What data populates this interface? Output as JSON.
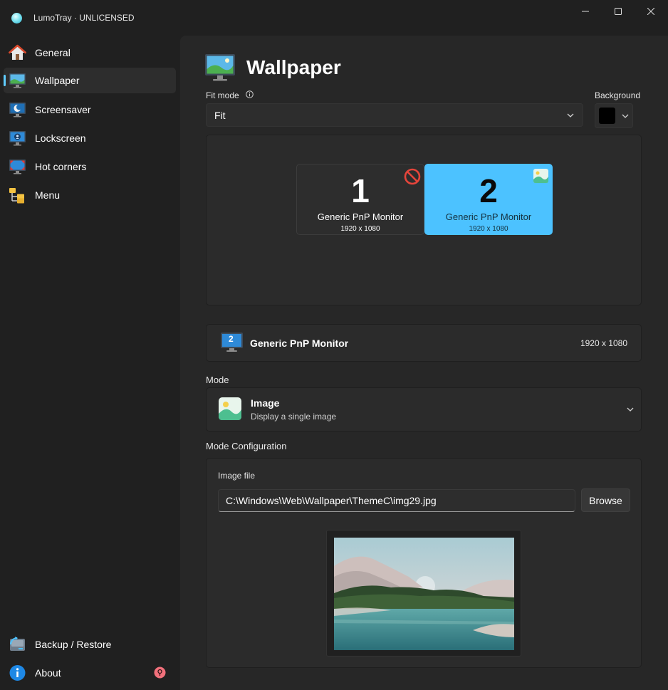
{
  "window": {
    "title": "LumoTray · UNLICENSED",
    "controls": [
      "minimize",
      "maximize",
      "close"
    ]
  },
  "sidebar": {
    "items": [
      {
        "label": "General",
        "icon": "home-icon"
      },
      {
        "label": "Wallpaper",
        "icon": "wallpaper-monitor-icon",
        "selected": true
      },
      {
        "label": "Screensaver",
        "icon": "screensaver-moon-icon"
      },
      {
        "label": "Lockscreen",
        "icon": "lockscreen-user-icon"
      },
      {
        "label": "Hot corners",
        "icon": "hot-corners-icon"
      },
      {
        "label": "Menu",
        "icon": "menu-folders-icon"
      }
    ],
    "footer": [
      {
        "label": "Backup / Restore",
        "icon": "backup-restore-icon"
      },
      {
        "label": "About",
        "icon": "info-icon"
      }
    ]
  },
  "page": {
    "title": "Wallpaper",
    "fit_mode_label": "Fit mode",
    "fit_mode_value": "Fit",
    "background_label": "Background",
    "background_color": "#000000"
  },
  "monitors": [
    {
      "number": "1",
      "name": "Generic PnP Monitor",
      "resolution": "1920 x 1080",
      "selected": false,
      "status_icon": "disabled-icon"
    },
    {
      "number": "2",
      "name": "Generic PnP Monitor",
      "resolution": "1920 x 1080",
      "selected": true,
      "status_icon": "image-icon"
    }
  ],
  "selected_monitor": {
    "number": "2",
    "name": "Generic PnP Monitor",
    "resolution": "1920 x 1080"
  },
  "mode": {
    "label": "Mode",
    "title": "Image",
    "description": "Display a single image"
  },
  "mode_config": {
    "label": "Mode Configuration",
    "image_file_label": "Image file",
    "image_path": "C:\\Windows\\Web\\Wallpaper\\ThemeC\\img29.jpg",
    "browse_label": "Browse"
  },
  "colors": {
    "accent": "#60cdff",
    "monitor_selected": "#4cc2ff",
    "about_badge": "#f1707b"
  }
}
